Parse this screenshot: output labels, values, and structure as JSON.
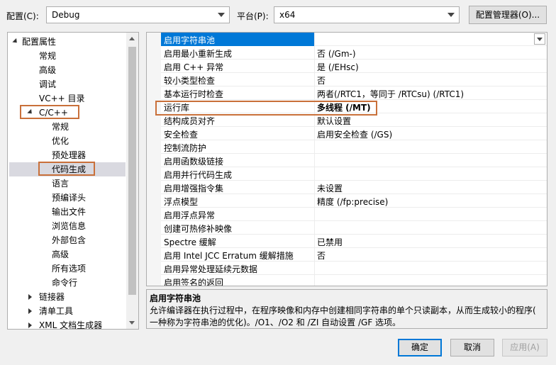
{
  "toolbar": {
    "config_label": "配置(C):",
    "config_value": "Debug",
    "platform_label": "平台(P):",
    "platform_value": "x64",
    "config_manager_button": "配置管理器(O)..."
  },
  "tree": {
    "items": [
      {
        "label": "配置属性",
        "expander": "open"
      },
      {
        "label": "常规"
      },
      {
        "label": "高级"
      },
      {
        "label": "调试"
      },
      {
        "label": "VC++ 目录"
      },
      {
        "label": "C/C++",
        "expander": "open"
      },
      {
        "label": "常规"
      },
      {
        "label": "优化"
      },
      {
        "label": "预处理器"
      },
      {
        "label": "代码生成",
        "selected": true
      },
      {
        "label": "语言"
      },
      {
        "label": "预编译头"
      },
      {
        "label": "输出文件"
      },
      {
        "label": "浏览信息"
      },
      {
        "label": "外部包含"
      },
      {
        "label": "高级"
      },
      {
        "label": "所有选项"
      },
      {
        "label": "命令行"
      },
      {
        "label": "链接器",
        "expander": "closed"
      },
      {
        "label": "清单工具",
        "expander": "closed"
      },
      {
        "label": "XML 文档生成器",
        "expander": "closed"
      }
    ]
  },
  "properties": {
    "rows": [
      {
        "name": "启用字符串池",
        "value": "",
        "selected": true
      },
      {
        "name": "启用最小重新生成",
        "value": "否 (/Gm-)"
      },
      {
        "name": "启用 C++ 异常",
        "value": "是 (/EHsc)"
      },
      {
        "name": "较小类型检查",
        "value": "否"
      },
      {
        "name": "基本运行时检查",
        "value": "两者(/RTC1，等同于 /RTCsu) (/RTC1)"
      },
      {
        "name": "运行库",
        "value": "多线程 (/MT)",
        "bold": true
      },
      {
        "name": "结构成员对齐",
        "value": "默认设置"
      },
      {
        "name": "安全检查",
        "value": "启用安全检查 (/GS)"
      },
      {
        "name": "控制流防护",
        "value": ""
      },
      {
        "name": "启用函数级链接",
        "value": ""
      },
      {
        "name": "启用并行代码生成",
        "value": ""
      },
      {
        "name": "启用增强指令集",
        "value": "未设置"
      },
      {
        "name": "浮点模型",
        "value": "精度 (/fp:precise)"
      },
      {
        "name": "启用浮点异常",
        "value": ""
      },
      {
        "name": "创建可热修补映像",
        "value": ""
      },
      {
        "name": "Spectre 缓解",
        "value": "已禁用"
      },
      {
        "name": "启用 Intel JCC Erratum 缓解措施",
        "value": "否"
      },
      {
        "name": "启用异常处理延续元数据",
        "value": ""
      },
      {
        "name": "启用签名的返回",
        "value": ""
      }
    ]
  },
  "description": {
    "title": "启用字符串池",
    "line1": "允许编译器在执行过程中，在程序映像和内存中创建相同字符串的单个只读副本，从而生成较小的程序(",
    "line2": "一种称为字符串池的优化)。/O1、/O2 和 /ZI 自动设置 /GF 选项。"
  },
  "footer": {
    "ok": "确定",
    "cancel": "取消",
    "apply": "应用(A)"
  },
  "colors": {
    "selection": "#0078d7",
    "highlight_box": "#c9703a"
  }
}
